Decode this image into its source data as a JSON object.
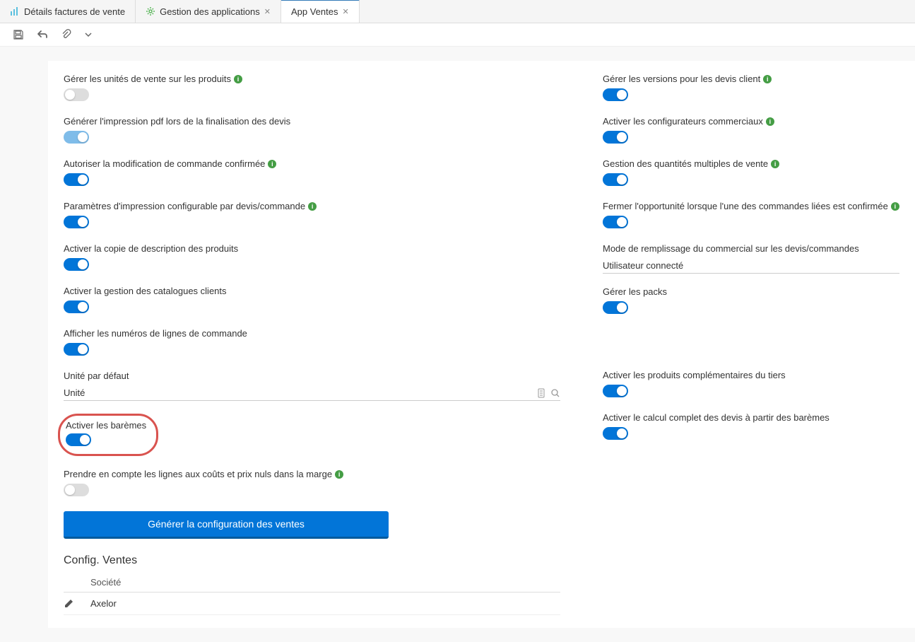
{
  "tabs": [
    {
      "label": "Détails factures de vente",
      "closable": false
    },
    {
      "label": "Gestion des applications",
      "closable": true
    },
    {
      "label": "App Ventes",
      "closable": true,
      "active": true
    }
  ],
  "left_fields": [
    {
      "key": "units_sale",
      "label": "Gérer les unités de vente sur les produits",
      "info": true,
      "toggle": "off"
    },
    {
      "key": "pdf_quote",
      "label": "Générer l'impression pdf lors de la finalisation des devis",
      "info": false,
      "toggle": "on_light"
    },
    {
      "key": "modify_confirmed",
      "label": "Autoriser la modification de commande confirmée",
      "info": true,
      "toggle": "on"
    },
    {
      "key": "print_params",
      "label": "Paramètres d'impression configurable par devis/commande",
      "info": true,
      "toggle": "on"
    },
    {
      "key": "copy_desc",
      "label": "Activer la copie de description des produits",
      "info": false,
      "toggle": "on"
    },
    {
      "key": "catalog_mgmt",
      "label": "Activer la gestion des catalogues clients",
      "info": false,
      "toggle": "on"
    },
    {
      "key": "line_numbers",
      "label": "Afficher les numéros de lignes de commande",
      "info": false,
      "toggle": "on"
    }
  ],
  "unit_default": {
    "label": "Unité par défaut",
    "value": "Unité"
  },
  "baremes": {
    "label": "Activer les barèmes",
    "toggle": "on"
  },
  "margin_zero": {
    "label": "Prendre en compte les lignes aux coûts et prix nuls dans la marge",
    "info": true,
    "toggle": "off"
  },
  "generate_btn": "Générer la configuration des ventes",
  "right_fields": [
    {
      "key": "versions_quote",
      "label": "Gérer les versions pour les devis client",
      "info": true,
      "toggle": "on"
    },
    {
      "key": "configurators",
      "label": "Activer les configurateurs commerciaux",
      "info": true,
      "toggle": "on"
    },
    {
      "key": "multi_qty",
      "label": "Gestion des quantités multiples de vente",
      "info": true,
      "toggle": "on"
    },
    {
      "key": "close_oppo",
      "label": "Fermer l'opportunité lorsque l'une des commandes liées est confirmée",
      "info": true,
      "toggle": "on"
    }
  ],
  "fill_mode": {
    "label": "Mode de remplissage du commercial sur les devis/commandes",
    "value": "Utilisateur connecté"
  },
  "right_fields2": [
    {
      "key": "packs",
      "label": "Gérer les packs",
      "info": false,
      "toggle": "on"
    }
  ],
  "right_fields3": [
    {
      "key": "comp_products",
      "label": "Activer les produits complémentaires du tiers",
      "info": false,
      "toggle": "on"
    },
    {
      "key": "full_calc",
      "label": "Activer le calcul complet des devis à partir des barèmes",
      "info": false,
      "toggle": "on"
    }
  ],
  "config_section": {
    "title": "Config. Ventes",
    "header": "Société",
    "rows": [
      {
        "label": "Axelor"
      }
    ]
  }
}
